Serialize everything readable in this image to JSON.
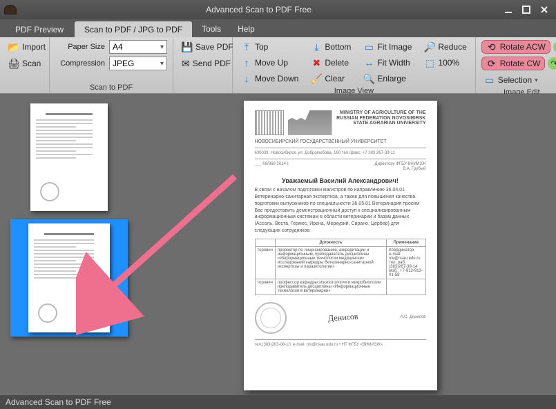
{
  "window": {
    "title": "Advanced Scan to PDF Free"
  },
  "tabs": {
    "pdf_preview": "PDF Preview",
    "scan_to_pdf": "Scan to PDF / JPG to PDF",
    "tools": "Tools",
    "help": "Help"
  },
  "ribbon": {
    "group1": {
      "import": "Import",
      "scan": "Scan"
    },
    "group2": {
      "paper_size_label": "Paper Size",
      "paper_size_value": "A4",
      "compression_label": "Compression",
      "compression_value": "JPEG",
      "label": "Scan to PDF"
    },
    "group3": {
      "save_pdf": "Save PDF",
      "send_pdf": "Send PDF"
    },
    "group4": {
      "top": "Top",
      "move_up": "Move Up",
      "move_down": "Move Down",
      "bottom": "Bottom",
      "delete": "Delete",
      "clear": "Clear",
      "fit_image": "Fit Image",
      "fit_width": "Fit Width",
      "enlarge": "Enlarge",
      "reduce": "Reduce",
      "hundred": "100%",
      "label": "Image View"
    },
    "group5": {
      "rotate_acw": "Rotate ACW",
      "rotate_cw": "Rotate CW",
      "selection": "Selection",
      "label": "Image Edit"
    }
  },
  "document": {
    "header_left": "НОВОСИБИРСКИЙ\nГОСУДАРСТВЕННЫЙ\nУНИВЕРСИТЕТ",
    "header_right": "MINISTRY OF AGRICULTURE\nOF THE RUSSIAN FEDERATION\nNOVOSIBIRSK\nSTATE AGRARIAN\nUNIVERSITY",
    "contact": "630039, Новосибирск, ул. Добролюбова, 160   тел./факс: +7 383 267-38-11",
    "date_line": "___-08/868    2014 г.",
    "addressee": "Директору ФГБУ ВНИИЗЖ\nВ.А. Грубый",
    "salutation": "Уважаемый Василий Александрович!",
    "body": "В связи с началом подготовки магистров по направлению 36.04.01 Ветеринарно-санитарная экспертиза, а также для повышения качества подготовки выпускников по специальности 36.05.01 Ветеринария просим Вас предоставить демонстрационный доступ к специализированным информационным системам в области ветеринарии и базам данных (Ассоль, Веста, Гермес, Ирена, Меркурий, Сирано, Цербер) для следующих сотрудников:",
    "table": {
      "headers": [
        "",
        "Должность",
        "Примечание"
      ],
      "rows": [
        [
          "торович",
          "проректор по лицензированию, аккредитации и информационным, преподаватель дисциплины «Информационные технологии медицинских исследований кафедры Ветеринарно-санитарной экспертизы и паразитологии»",
          "Координатор\ne-mail: niv@nsau.edu.ru\nтел. раб: (383)267-39-14\nмоб.: +7-913-913-01-58"
        ],
        [
          "торович",
          "профессор кафедры эпизоотологии и микробиологии преподаватель дисциплины «Информационные технологии в ветеринарии»",
          ""
        ]
      ]
    },
    "signatory": "А.С. Денисов",
    "footer": "тел.(383)203-08-10, e-mail: niv@nsau.edu.ru • НТ   ФГБУ «ВНИИЗЖ»"
  },
  "statusbar": {
    "text": "Advanced Scan to PDF Free"
  }
}
